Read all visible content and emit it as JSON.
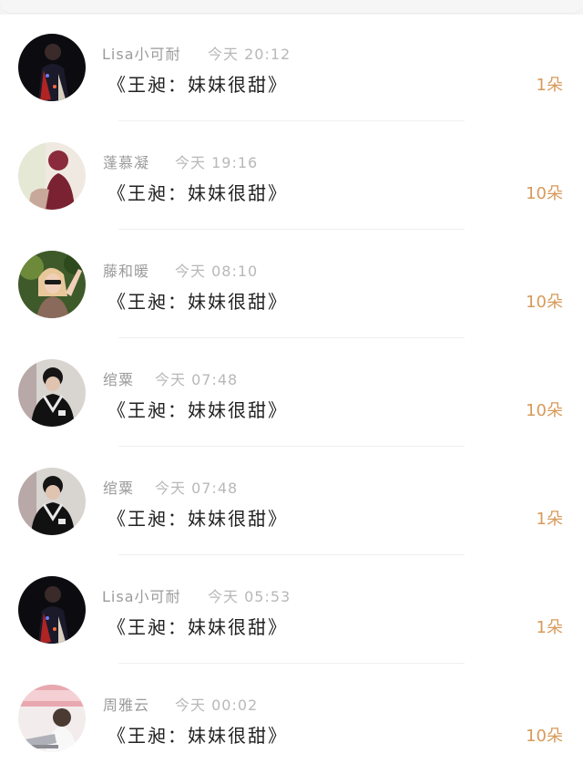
{
  "records": [
    {
      "name": "Lisa小可耐",
      "time": "今天 20:12",
      "gift": "《王昶：妹妹很甜》",
      "count": "1朵",
      "avatar": "dark-performer-avatar"
    },
    {
      "name": "蓬慕凝",
      "time": "今天 19:16",
      "gift": "《王昶：妹妹很甜》",
      "count": "10朵",
      "avatar": "pink-silhouette-avatar"
    },
    {
      "name": "藤和暖",
      "time": "今天 08:10",
      "gift": "《王昶：妹妹很甜》",
      "count": "10朵",
      "avatar": "sunglasses-girl-avatar"
    },
    {
      "name": "绾粟",
      "time": "今天 07:48",
      "gift": "《王昶：妹妹很甜》",
      "count": "10朵",
      "avatar": "boy-sweater-avatar"
    },
    {
      "name": "绾粟",
      "time": "今天 07:48",
      "gift": "《王昶：妹妹很甜》",
      "count": "1朵",
      "avatar": "boy-sweater-avatar"
    },
    {
      "name": "Lisa小可耐",
      "time": "今天 05:53",
      "gift": "《王昶：妹妹很甜》",
      "count": "1朵",
      "avatar": "dark-performer-avatar"
    },
    {
      "name": "周雅云",
      "time": "今天 00:02",
      "gift": "《王昶：妹妹很甜》",
      "count": "10朵",
      "avatar": "girl-laptop-avatar"
    }
  ],
  "colors": {
    "count": "#d79a5a",
    "name": "#9b9b9b",
    "time": "#b8b8b8",
    "title": "#222222"
  }
}
